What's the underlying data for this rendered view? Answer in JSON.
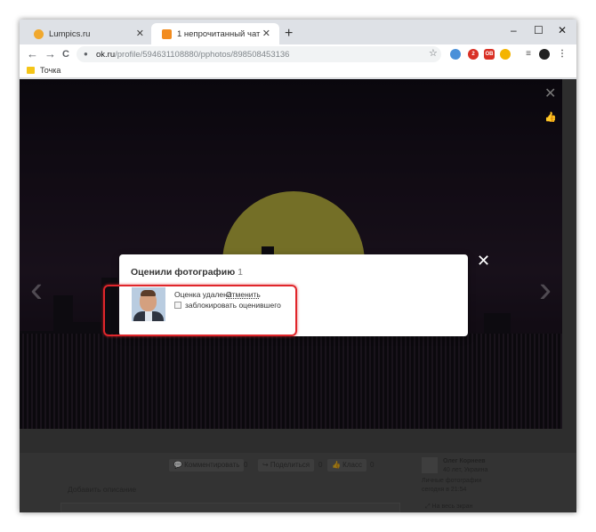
{
  "browser": {
    "tabs": [
      {
        "label": "Lumpics.ru",
        "favicon_color": "#f0a82e",
        "active": false
      },
      {
        "label": "1 непрочитанный чат",
        "favicon_color": "#f28c1f",
        "active": true
      }
    ],
    "close_glyph": "✕",
    "new_tab_glyph": "+",
    "window_controls": {
      "minimize": "–",
      "maximize": "☐",
      "close": "✕"
    },
    "nav": {
      "back": "←",
      "forward": "→",
      "reload": "C"
    },
    "address": {
      "host": "ok.ru",
      "path": "/profile/594631108880/pphotos/898508453136",
      "lock_icon": "lock-icon"
    },
    "star_glyph": "☆",
    "extensions": [
      {
        "name": "ext-blue-icon",
        "color": "#4a90d9",
        "text": ""
      },
      {
        "name": "ext-red-badge-icon",
        "color": "#d93025",
        "text": "2"
      },
      {
        "name": "ext-ok-icon",
        "color": "#d93025",
        "text": "OB"
      },
      {
        "name": "ext-yellow-icon",
        "color": "#f4b400",
        "text": ""
      }
    ],
    "bookmarks": [
      {
        "label": "Точка"
      }
    ]
  },
  "page": {
    "close_glyph": "✕",
    "like_glyph": "👍",
    "prev_glyph": "‹",
    "next_glyph": "›",
    "actions": [
      {
        "label": "💬 Комментировать",
        "count": "0"
      },
      {
        "label": "↪ Поделиться",
        "count": "0"
      },
      {
        "label": "👍 Класс",
        "count": "0"
      }
    ],
    "description_placeholder": "Добавить описание",
    "author": {
      "name": "Олег Корнеев",
      "meta": "40 лет, Украина",
      "album": "Личные фотографии",
      "time": "сегодня в 21:54"
    },
    "fullscreen_label": "⤢ На весь экран"
  },
  "modal": {
    "title": "Оценили фотографию",
    "count": "1",
    "close_glyph": "✕",
    "rating_removed": "Оценка удалена",
    "undo": "Отменить",
    "block_label": "заблокировать оценившего",
    "highlight_color": "#e0262b"
  }
}
